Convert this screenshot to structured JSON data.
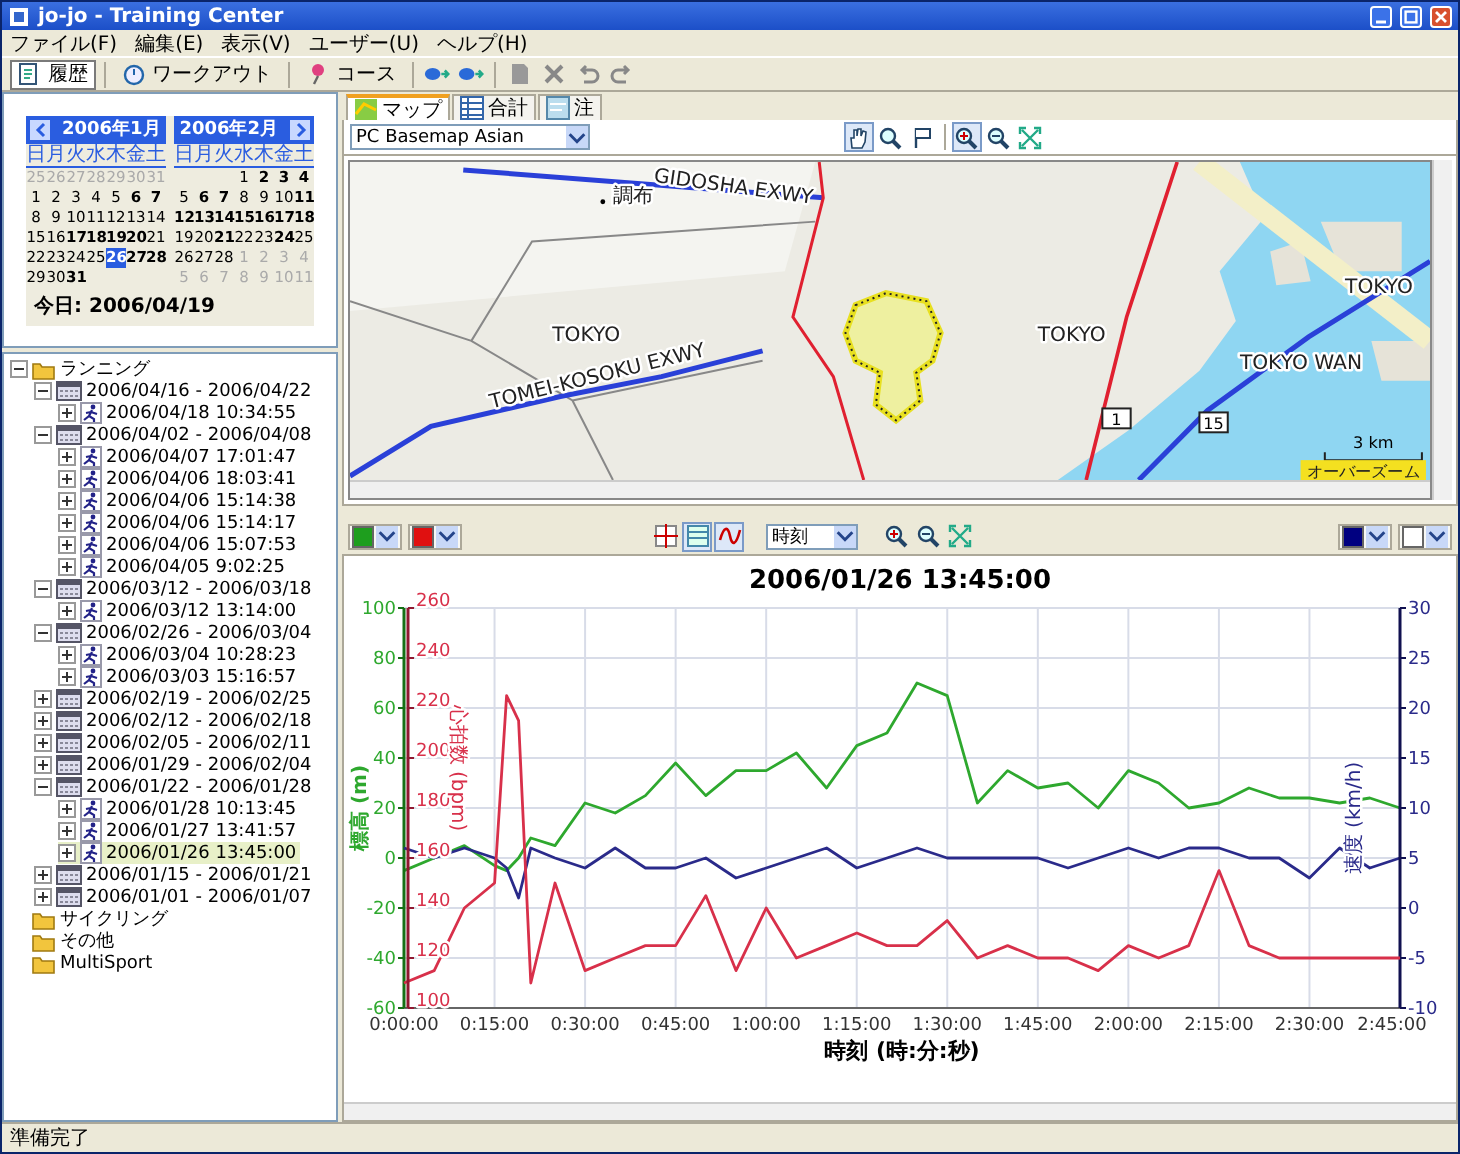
{
  "window": {
    "title": "jo-jo - Training Center"
  },
  "menu": [
    "ファイル(F)",
    "編集(E)",
    "表示(V)",
    "ユーザー(U)",
    "ヘルプ(H)"
  ],
  "views": [
    {
      "label": "履歴",
      "selected": true
    },
    {
      "label": "ワークアウト",
      "selected": false
    },
    {
      "label": "コース",
      "selected": false
    }
  ],
  "calendars": [
    {
      "month": "2006年1月",
      "weekdays": [
        "日",
        "月",
        "火",
        "水",
        "木",
        "金",
        "土"
      ],
      "weeks": [
        [
          {
            "day": "25",
            "kind": "other"
          },
          {
            "day": "26",
            "kind": "other"
          },
          {
            "day": "27",
            "kind": "other"
          },
          {
            "day": "28",
            "kind": "other"
          },
          {
            "day": "29",
            "kind": "other"
          },
          {
            "day": "30",
            "kind": "other"
          },
          {
            "day": "31",
            "kind": "other"
          }
        ],
        [
          {
            "day": "1",
            "kind": "day"
          },
          {
            "day": "2",
            "kind": "day"
          },
          {
            "day": "3",
            "kind": "day"
          },
          {
            "day": "4",
            "kind": "day"
          },
          {
            "day": "5",
            "kind": "day"
          },
          {
            "day": "6",
            "kind": "workout"
          },
          {
            "day": "7",
            "kind": "workout"
          }
        ],
        [
          {
            "day": "8",
            "kind": "day"
          },
          {
            "day": "9",
            "kind": "day"
          },
          {
            "day": "10",
            "kind": "day"
          },
          {
            "day": "11",
            "kind": "day"
          },
          {
            "day": "12",
            "kind": "day"
          },
          {
            "day": "13",
            "kind": "day"
          },
          {
            "day": "14",
            "kind": "day"
          }
        ],
        [
          {
            "day": "15",
            "kind": "day"
          },
          {
            "day": "16",
            "kind": "day"
          },
          {
            "day": "17",
            "kind": "workout"
          },
          {
            "day": "18",
            "kind": "workout"
          },
          {
            "day": "19",
            "kind": "workout"
          },
          {
            "day": "20",
            "kind": "workout"
          },
          {
            "day": "21",
            "kind": "day"
          }
        ],
        [
          {
            "day": "22",
            "kind": "day"
          },
          {
            "day": "23",
            "kind": "day"
          },
          {
            "day": "24",
            "kind": "day"
          },
          {
            "day": "25",
            "kind": "day"
          },
          {
            "day": "26",
            "kind": "selected"
          },
          {
            "day": "27",
            "kind": "workout"
          },
          {
            "day": "28",
            "kind": "workout"
          }
        ],
        [
          {
            "day": "29",
            "kind": "day"
          },
          {
            "day": "30",
            "kind": "day"
          },
          {
            "day": "31",
            "kind": "workout"
          },
          {
            "kind": "blank"
          },
          {
            "kind": "blank"
          },
          {
            "kind": "blank"
          },
          {
            "kind": "blank"
          }
        ]
      ]
    },
    {
      "month": "2006年2月",
      "weekdays": [
        "日",
        "月",
        "火",
        "水",
        "木",
        "金",
        "土"
      ],
      "weeks": [
        [
          {
            "kind": "blank"
          },
          {
            "kind": "blank"
          },
          {
            "kind": "blank"
          },
          {
            "day": "1",
            "kind": "day"
          },
          {
            "day": "2",
            "kind": "workout"
          },
          {
            "day": "3",
            "kind": "workout"
          },
          {
            "day": "4",
            "kind": "workout"
          }
        ],
        [
          {
            "day": "5",
            "kind": "day"
          },
          {
            "day": "6",
            "kind": "workout"
          },
          {
            "day": "7",
            "kind": "workout"
          },
          {
            "day": "8",
            "kind": "day"
          },
          {
            "day": "9",
            "kind": "day"
          },
          {
            "day": "10",
            "kind": "day"
          },
          {
            "day": "11",
            "kind": "workout"
          }
        ],
        [
          {
            "day": "12",
            "kind": "workout"
          },
          {
            "day": "13",
            "kind": "workout"
          },
          {
            "day": "14",
            "kind": "workout"
          },
          {
            "day": "15",
            "kind": "workout"
          },
          {
            "day": "16",
            "kind": "workout"
          },
          {
            "day": "17",
            "kind": "workout"
          },
          {
            "day": "18",
            "kind": "workout"
          }
        ],
        [
          {
            "day": "19",
            "kind": "day"
          },
          {
            "day": "20",
            "kind": "day"
          },
          {
            "day": "21",
            "kind": "workout"
          },
          {
            "day": "22",
            "kind": "day"
          },
          {
            "day": "23",
            "kind": "day"
          },
          {
            "day": "24",
            "kind": "workout"
          },
          {
            "day": "25",
            "kind": "day"
          }
        ],
        [
          {
            "day": "26",
            "kind": "day"
          },
          {
            "day": "27",
            "kind": "day"
          },
          {
            "day": "28",
            "kind": "day"
          },
          {
            "day": "1",
            "kind": "other"
          },
          {
            "day": "2",
            "kind": "other"
          },
          {
            "day": "3",
            "kind": "other"
          },
          {
            "day": "4",
            "kind": "other"
          }
        ],
        [
          {
            "day": "5",
            "kind": "other"
          },
          {
            "day": "6",
            "kind": "other"
          },
          {
            "day": "7",
            "kind": "other"
          },
          {
            "day": "8",
            "kind": "other"
          },
          {
            "day": "9",
            "kind": "other"
          },
          {
            "day": "10",
            "kind": "other"
          },
          {
            "day": "11",
            "kind": "other"
          }
        ]
      ]
    }
  ],
  "today": "今日: 2006/04/19",
  "tree": [
    {
      "label": "ランニング",
      "kind": "folder",
      "expanded": true,
      "selected": false,
      "children": [
        {
          "label": "2006/04/16 - 2006/04/22",
          "kind": "week",
          "expanded": true,
          "selected": false,
          "children": [
            {
              "label": "2006/04/18 10:34:55",
              "kind": "workout",
              "expanded": false,
              "selected": false
            }
          ]
        },
        {
          "label": "2006/04/02 - 2006/04/08",
          "kind": "week",
          "expanded": true,
          "selected": false,
          "children": [
            {
              "label": "2006/04/07 17:01:47",
              "kind": "workout",
              "expanded": false,
              "selected": false
            },
            {
              "label": "2006/04/06 18:03:41",
              "kind": "workout",
              "expanded": false,
              "selected": false
            },
            {
              "label": "2006/04/06 15:14:38",
              "kind": "workout",
              "expanded": false,
              "selected": false
            },
            {
              "label": "2006/04/06 15:14:17",
              "kind": "workout",
              "expanded": false,
              "selected": false
            },
            {
              "label": "2006/04/06 15:07:53",
              "kind": "workout",
              "expanded": false,
              "selected": false
            },
            {
              "label": "2006/04/05 9:02:25",
              "kind": "workout",
              "expanded": false,
              "selected": false
            }
          ]
        },
        {
          "label": "2006/03/12 - 2006/03/18",
          "kind": "week",
          "expanded": true,
          "selected": false,
          "children": [
            {
              "label": "2006/03/12 13:14:00",
              "kind": "workout",
              "expanded": false,
              "selected": false
            }
          ]
        },
        {
          "label": "2006/02/26 - 2006/03/04",
          "kind": "week",
          "expanded": true,
          "selected": false,
          "children": [
            {
              "label": "2006/03/04 10:28:23",
              "kind": "workout",
              "expanded": false,
              "selected": false
            },
            {
              "label": "2006/03/03 15:16:57",
              "kind": "workout",
              "expanded": false,
              "selected": false
            }
          ]
        },
        {
          "label": "2006/02/19 - 2006/02/25",
          "kind": "week",
          "expanded": false,
          "selected": false
        },
        {
          "label": "2006/02/12 - 2006/02/18",
          "kind": "week",
          "expanded": false,
          "selected": false
        },
        {
          "label": "2006/02/05 - 2006/02/11",
          "kind": "week",
          "expanded": false,
          "selected": false
        },
        {
          "label": "2006/01/29 - 2006/02/04",
          "kind": "week",
          "expanded": false,
          "selected": false
        },
        {
          "label": "2006/01/22 - 2006/01/28",
          "kind": "week",
          "expanded": true,
          "selected": false,
          "children": [
            {
              "label": "2006/01/28 10:13:45",
              "kind": "workout",
              "expanded": false,
              "selected": false
            },
            {
              "label": "2006/01/27 13:41:57",
              "kind": "workout",
              "expanded": false,
              "selected": false
            },
            {
              "label": "2006/01/26 13:45:00",
              "kind": "workout",
              "expanded": false,
              "selected": true
            }
          ]
        },
        {
          "label": "2006/01/15 - 2006/01/21",
          "kind": "week",
          "expanded": false,
          "selected": false
        },
        {
          "label": "2006/01/01 - 2006/01/07",
          "kind": "week",
          "expanded": false,
          "selected": false
        }
      ]
    },
    {
      "label": "サイクリング",
      "kind": "folder",
      "expanded": false,
      "selected": false
    },
    {
      "label": "その他",
      "kind": "folder",
      "expanded": false,
      "selected": false
    },
    {
      "label": "MultiSport",
      "kind": "folder",
      "expanded": false,
      "selected": false
    }
  ],
  "tabs": [
    {
      "label": "マップ",
      "selected": true
    },
    {
      "label": "合計",
      "selected": false
    },
    {
      "label": "注",
      "selected": false
    }
  ],
  "map": {
    "basemap": "PC Basemap Asian",
    "tools": [
      {
        "kind": "pan",
        "selected": true
      },
      {
        "kind": "zoom",
        "selected": false
      },
      {
        "kind": "flag",
        "selected": false
      },
      {
        "kind": "zoom-in",
        "selected": true
      },
      {
        "kind": "zoom-out",
        "selected": false
      },
      {
        "kind": "fit",
        "selected": false
      }
    ],
    "labels": [
      "GIDOSHA EXWY",
      "調布",
      "TOKYO",
      "TOMEI-KOSOKU EXWY",
      "TOKYO",
      "TOKYO",
      "TOKYO WAN"
    ],
    "route_shields": [
      "1",
      "15"
    ],
    "scale": "3 km",
    "overzoom": "オーバーズーム"
  },
  "chart_toolbar": {
    "left_colors": [
      {
        "color": "#1e9e1e"
      },
      {
        "color": "#e01010"
      }
    ],
    "tools": [
      {
        "kind": "crosshair",
        "selected": false
      },
      {
        "kind": "grid",
        "selected": true
      },
      {
        "kind": "smooth",
        "selected": true
      }
    ],
    "x_axis": "時刻",
    "zoom_tools": [
      {
        "kind": "zoom-in",
        "selected": false
      },
      {
        "kind": "zoom-out",
        "selected": false
      },
      {
        "kind": "fit",
        "selected": false
      }
    ],
    "right_colors": [
      {
        "color": "#000080"
      },
      {
        "color": "#ffffff"
      }
    ]
  },
  "chart": {
    "chart_data": {
      "type": "line",
      "title": "2006/01/26 13:45:00",
      "xlabel": "時刻 (時:分:秒)",
      "ylabel": "標高 (m)",
      "grid": true,
      "x": [
        0,
        5,
        10,
        15,
        17,
        19,
        21,
        25,
        30,
        35,
        40,
        45,
        50,
        55,
        60,
        65,
        70,
        75,
        80,
        85,
        90,
        95,
        100,
        105,
        110,
        115,
        120,
        125,
        130,
        135,
        140,
        145,
        150,
        155,
        160,
        165
      ],
      "series": [
        {
          "color": "#2ea82e",
          "values": [
            -5,
            0,
            5,
            -3,
            -5,
            0,
            8,
            5,
            22,
            18,
            25,
            38,
            25,
            35,
            35,
            42,
            28,
            45,
            50,
            70,
            65,
            22,
            35,
            28,
            30,
            20,
            35,
            30,
            20,
            22,
            28,
            24,
            24,
            22,
            24,
            20
          ]
        }
      ],
      "xlim": [
        0,
        165
      ],
      "ylim": [
        -60,
        100
      ],
      "xticks": [
        {
          "value": 0,
          "label": "0:00:00"
        },
        {
          "value": 15,
          "label": "0:15:00"
        },
        {
          "value": 30,
          "label": "0:30:00"
        },
        {
          "value": 45,
          "label": "0:45:00"
        },
        {
          "value": 60,
          "label": "1:00:00"
        },
        {
          "value": 75,
          "label": "1:15:00"
        },
        {
          "value": 90,
          "label": "1:30:00"
        },
        {
          "value": 105,
          "label": "1:45:00"
        },
        {
          "value": 120,
          "label": "2:00:00"
        },
        {
          "value": 135,
          "label": "2:15:00"
        },
        {
          "value": 150,
          "label": "2:30:00"
        },
        {
          "value": 165,
          "label": "2:45:00"
        }
      ],
      "yticks": [
        -60,
        -40,
        -20,
        0,
        20,
        40,
        60,
        80,
        100
      ]
    },
    "heart_rate": {
      "chart_data": {
        "type": "line",
        "ylabel": "心拍数 (bpm)",
        "x": [
          0,
          5,
          10,
          15,
          17,
          19,
          21,
          25,
          30,
          35,
          40,
          45,
          50,
          55,
          60,
          65,
          70,
          75,
          80,
          85,
          90,
          95,
          100,
          105,
          110,
          115,
          120,
          125,
          130,
          135,
          140,
          145,
          150,
          155,
          160,
          165
        ],
        "series": [
          {
            "color": "#d8304a",
            "values": [
              110,
              115,
              140,
              150,
              225,
              215,
              110,
              150,
              115,
              120,
              125,
              125,
              145,
              115,
              140,
              120,
              125,
              130,
              125,
              125,
              135,
              120,
              125,
              120,
              120,
              115,
              125,
              120,
              125,
              155,
              125,
              120,
              120,
              120,
              120,
              120
            ]
          }
        ],
        "xlim": [
          0,
          165
        ],
        "ylim": [
          100,
          260
        ],
        "yticks": [
          100,
          120,
          140,
          160,
          180,
          200,
          220,
          240,
          260
        ]
      }
    },
    "speed": {
      "chart_data": {
        "type": "line",
        "ylabel": "速度 (km/h)",
        "x": [
          0,
          5,
          10,
          15,
          17,
          19,
          21,
          25,
          30,
          35,
          40,
          45,
          50,
          55,
          60,
          65,
          70,
          75,
          80,
          85,
          90,
          95,
          100,
          105,
          110,
          115,
          120,
          125,
          130,
          135,
          140,
          145,
          150,
          155,
          160,
          165
        ],
        "series": [
          {
            "color": "#2a2a8a",
            "values": [
              6,
              5,
              6,
              5,
              4,
              1,
              6,
              5,
              4,
              6,
              4,
              4,
              5,
              3,
              4,
              5,
              6,
              4,
              5,
              6,
              5,
              5,
              5,
              5,
              4,
              5,
              6,
              5,
              6,
              6,
              5,
              5,
              3,
              6,
              4,
              5
            ]
          }
        ],
        "xlim": [
          0,
          165
        ],
        "ylim": [
          -10,
          30
        ],
        "yticks": [
          -10,
          -5,
          0,
          5,
          10,
          15,
          20,
          25,
          30
        ]
      }
    }
  },
  "status_bar": "準備完了"
}
